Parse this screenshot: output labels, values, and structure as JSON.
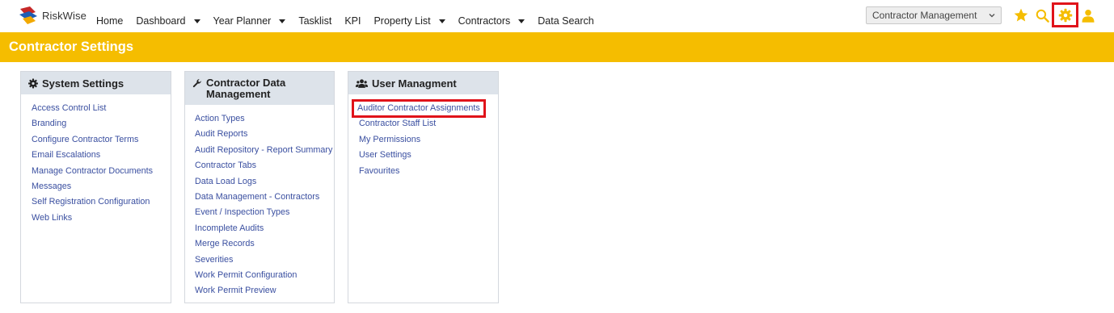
{
  "app": {
    "logo_text": "RiskWise"
  },
  "nav": {
    "items": [
      {
        "label": "Home",
        "dropdown": false
      },
      {
        "label": "Dashboard",
        "dropdown": true
      },
      {
        "label": "Year Planner",
        "dropdown": true
      },
      {
        "label": "Tasklist",
        "dropdown": false
      },
      {
        "label": "KPI",
        "dropdown": false
      },
      {
        "label": "Property List",
        "dropdown": true
      },
      {
        "label": "Contractors",
        "dropdown": true
      },
      {
        "label": "Data Search",
        "dropdown": false
      }
    ]
  },
  "module_select": {
    "value": "Contractor Management"
  },
  "header_icons": [
    "star-icon",
    "search-icon",
    "gear-icon",
    "user-icon"
  ],
  "colors": {
    "accent": "#f5bd00",
    "link": "#3a4fa0",
    "highlight": "#e0131a",
    "panel_header": "#dde3ea"
  },
  "page": {
    "title": "Contractor Settings"
  },
  "panels": [
    {
      "title": "System Settings",
      "icon": "gear-icon",
      "links": [
        "Access Control List",
        "Branding",
        "Configure Contractor Terms",
        "Email Escalations",
        "Manage Contractor Documents",
        "Messages",
        "Self Registration Configuration",
        "Web Links"
      ]
    },
    {
      "title": "Contractor Data Management",
      "icon": "wrench-icon",
      "links": [
        "Action Types",
        "Audit Reports",
        "Audit Repository - Report Summary",
        "Contractor Tabs",
        "Data Load Logs",
        "Data Management - Contractors",
        "Event / Inspection Types",
        "Incomplete Audits",
        "Merge Records",
        "Severities",
        "Work Permit Configuration",
        "Work Permit Preview"
      ]
    },
    {
      "title": "User Managment",
      "icon": "users-icon",
      "links": [
        "Auditor Contractor Assignments",
        "Contractor Staff List",
        "My Permissions",
        "User Settings",
        "Favourites"
      ]
    }
  ]
}
